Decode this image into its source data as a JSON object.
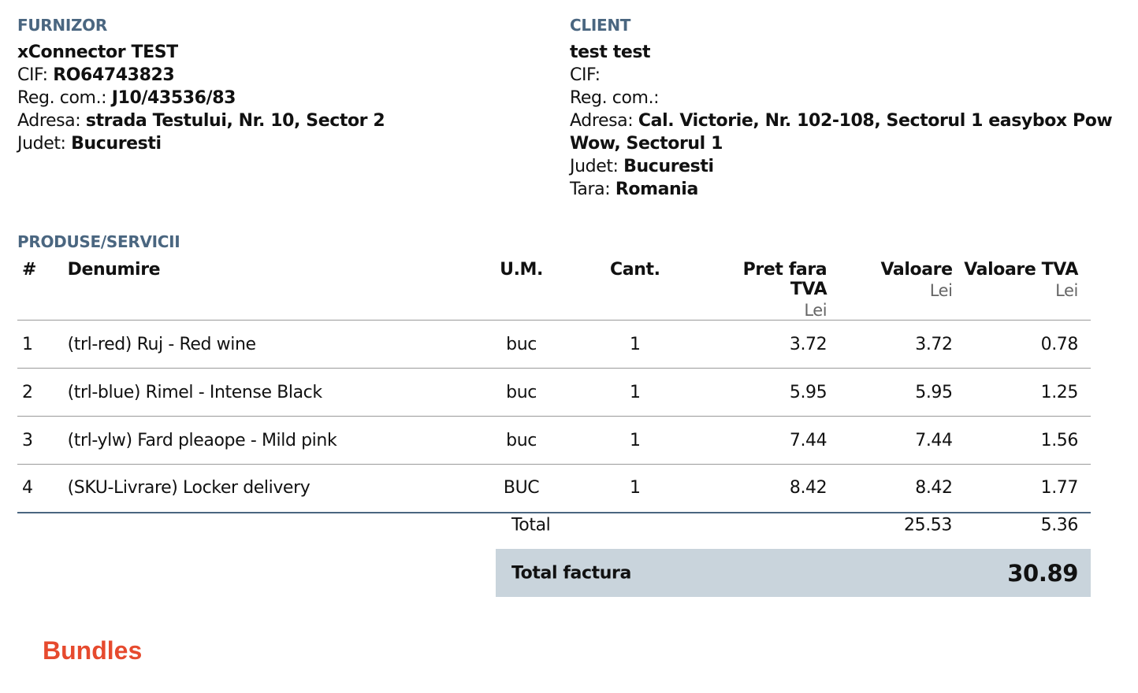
{
  "supplier": {
    "section_label": "FURNIZOR",
    "name": "xConnector TEST",
    "cif_label": "CIF:",
    "cif": "RO64743823",
    "reg_label": "Reg. com.:",
    "reg": "J10/43536/83",
    "address_label": "Adresa:",
    "address": "strada Testului, Nr. 10, Sector 2",
    "county_label": "Judet:",
    "county": "Bucuresti"
  },
  "client": {
    "section_label": "CLIENT",
    "name": "test test",
    "cif_label": "CIF:",
    "cif": "",
    "reg_label": "Reg. com.:",
    "reg": "",
    "address_label": "Adresa:",
    "address_line1": "Cal. Victorie, Nr. 102-108, Sectorul 1 easybox Pow",
    "address_line2": "Wow, Sectorul 1",
    "county_label": "Judet:",
    "county": "Bucuresti",
    "country_label": "Tara:",
    "country": "Romania"
  },
  "products": {
    "section_label": "PRODUSE/SERVICII",
    "headers": {
      "num": "#",
      "name": "Denumire",
      "um": "U.M.",
      "qty": "Cant.",
      "price": "Pret fara TVA",
      "value": "Valoare",
      "vat": "Valoare TVA",
      "currency": "Lei"
    },
    "rows": [
      {
        "num": "1",
        "name": "(trl-red) Ruj - Red wine",
        "um": "buc",
        "qty": "1",
        "price": "3.72",
        "value": "3.72",
        "vat": "0.78"
      },
      {
        "num": "2",
        "name": "(trl-blue) Rimel - Intense Black",
        "um": "buc",
        "qty": "1",
        "price": "5.95",
        "value": "5.95",
        "vat": "1.25"
      },
      {
        "num": "3",
        "name": "(trl-ylw) Fard pleaope - Mild pink",
        "um": "buc",
        "qty": "1",
        "price": "7.44",
        "value": "7.44",
        "vat": "1.56"
      },
      {
        "num": "4",
        "name": "(SKU-Livrare) Locker delivery",
        "um": "BUC",
        "qty": "1",
        "price": "8.42",
        "value": "8.42",
        "vat": "1.77"
      }
    ]
  },
  "totals": {
    "total_label": "Total",
    "total_value": "25.53",
    "total_vat": "5.36",
    "invoice_total_label": "Total factura",
    "invoice_total": "30.89"
  },
  "footer": {
    "bundles_label": "Bundles"
  },
  "colors": {
    "section_label": "#4a6680",
    "grand_total_bg": "#c9d4dc",
    "bundles": "#e64a2e"
  }
}
